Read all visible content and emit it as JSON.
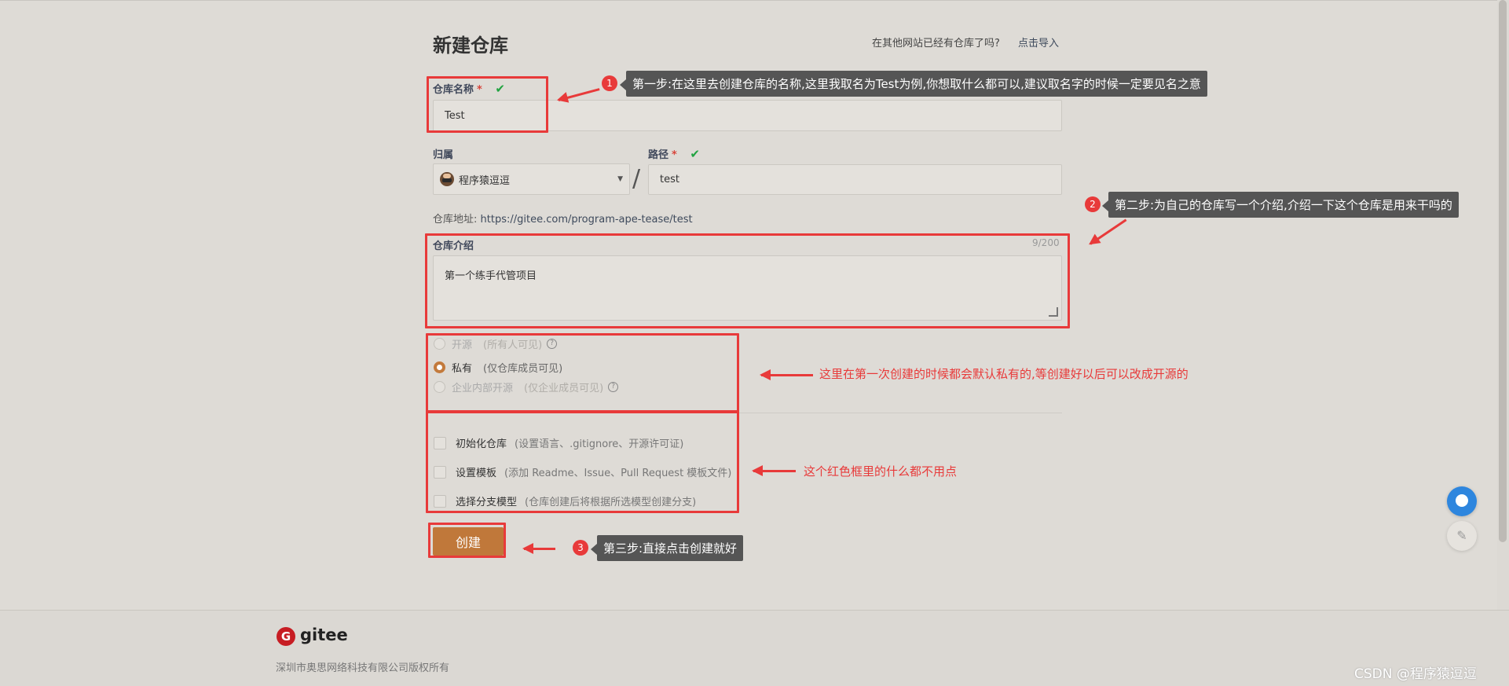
{
  "page": {
    "title": "新建仓库",
    "import_prompt": "在其他网站已经有仓库了吗?",
    "import_link": "点击导入"
  },
  "form": {
    "repo_name_label": "仓库名称",
    "required_mark": "*",
    "check": "✔",
    "repo_name_value": "Test",
    "owner_label": "归属",
    "owner_value": "程序猿逗逗",
    "slash": "/",
    "path_label": "路径",
    "path_value": "test",
    "address_label": "仓库地址:",
    "address_value": "https://gitee.com/program-ape-tease/test",
    "intro_label": "仓库介绍",
    "intro_counter": "9/200",
    "intro_value": "第一个练手代管项目",
    "visibility": [
      {
        "label": "开源",
        "desc": "(所有人可见)",
        "selected": false,
        "disabled": true,
        "help": "?"
      },
      {
        "label": "私有",
        "desc": "(仅仓库成员可见)",
        "selected": true,
        "disabled": false,
        "help": ""
      },
      {
        "label": "企业内部开源",
        "desc": "(仅企业成员可见)",
        "selected": false,
        "disabled": true,
        "help": "?"
      }
    ],
    "options": [
      {
        "label": "初始化仓库",
        "desc": "(设置语言、.gitignore、开源许可证)"
      },
      {
        "label": "设置模板",
        "desc": "(添加 Readme、Issue、Pull Request 模板文件)"
      },
      {
        "label": "选择分支模型",
        "desc": "(仓库创建后将根据所选模型创建分支)"
      }
    ],
    "submit_label": "创建"
  },
  "annotations": {
    "step1_num": "1",
    "step1_text": "第一步:在这里去创建仓库的名称,这里我取名为Test为例,你想取什么都可以,建议取名字的时候一定要见名之意",
    "step2_num": "2",
    "step2_text": "第二步:为自己的仓库写一个介绍,介绍一下这个仓库是用来干吗的",
    "step3_num": "3",
    "step3_text": "第三步:直接点击创建就好",
    "visibility_note": "这里在第一次创建的时候都会默认私有的,等创建好以后可以改成开源的",
    "options_note": "这个红色框里的什么都不用点"
  },
  "footer": {
    "logo_mark": "G",
    "logo_text": "gitee",
    "copyright": "深圳市奥思网络科技有限公司版权所有",
    "watermark": "CSDN @程序猿逗逗"
  },
  "colors": {
    "accent": "#c0783a",
    "annotation_red": "#e83a3a",
    "success_green": "#21a341"
  }
}
